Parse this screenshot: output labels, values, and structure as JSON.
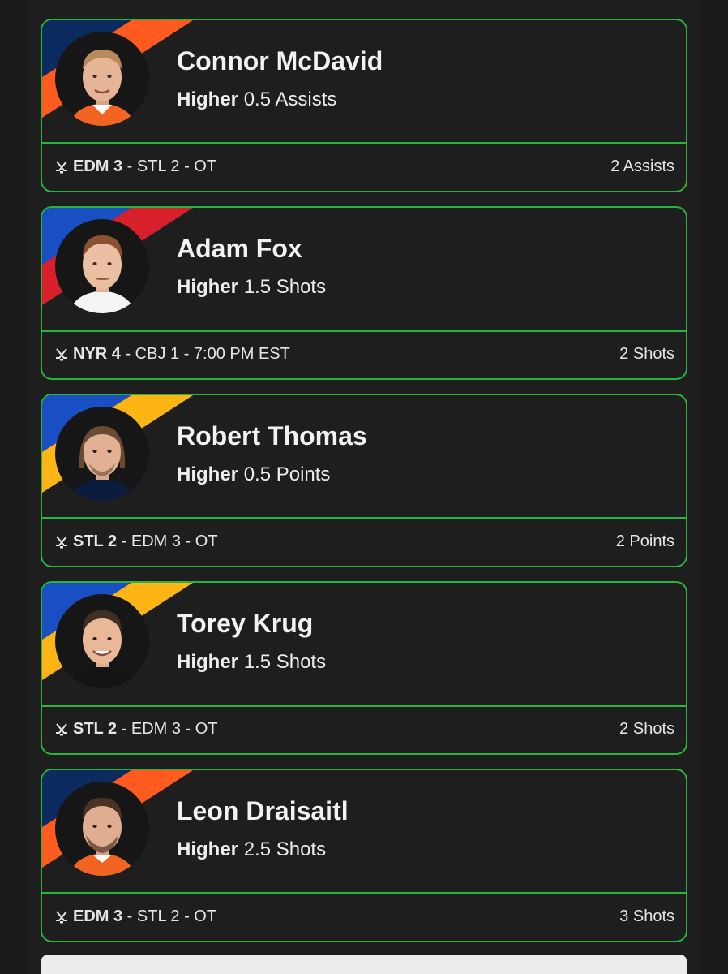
{
  "cards": [
    {
      "player": "Connor McDavid",
      "direction": "Higher",
      "line": "0.5 Assists",
      "team_main": "EDM 3",
      "game_rest": " - STL 2 - OT",
      "result": "2 Assists",
      "stripe_colors": [
        "#0b2a5e",
        "#ff5a1f"
      ],
      "jersey_color": "#f26422"
    },
    {
      "player": "Adam Fox",
      "direction": "Higher",
      "line": "1.5 Shots",
      "team_main": "NYR 4",
      "game_rest": " - CBJ 1 - 7:00 PM EST",
      "result": "2 Shots",
      "stripe_colors": [
        "#1a4fc4",
        "#d8202c"
      ],
      "jersey_color": "#f4f4f4"
    },
    {
      "player": "Robert Thomas",
      "direction": "Higher",
      "line": "0.5 Points",
      "team_main": "STL 2",
      "game_rest": " - EDM 3 - OT",
      "result": "2 Points",
      "stripe_colors": [
        "#1a4fc4",
        "#fcb514"
      ],
      "jersey_color": "#0c1c3c"
    },
    {
      "player": "Torey Krug",
      "direction": "Higher",
      "line": "1.5 Shots",
      "team_main": "STL 2",
      "game_rest": " - EDM 3 - OT",
      "result": "2 Shots",
      "stripe_colors": [
        "#1a4fc4",
        "#fcb514"
      ],
      "jersey_color": "#141414"
    },
    {
      "player": "Leon Draisaitl",
      "direction": "Higher",
      "line": "2.5 Shots",
      "team_main": "EDM 3",
      "game_rest": " - STL 2 - OT",
      "result": "3 Shots",
      "stripe_colors": [
        "#0b2a5e",
        "#ff5a1f"
      ],
      "jersey_color": "#f26422"
    }
  ],
  "accent_color": "#27b43a",
  "icons": {
    "sport": "hockey-sticks-icon"
  }
}
